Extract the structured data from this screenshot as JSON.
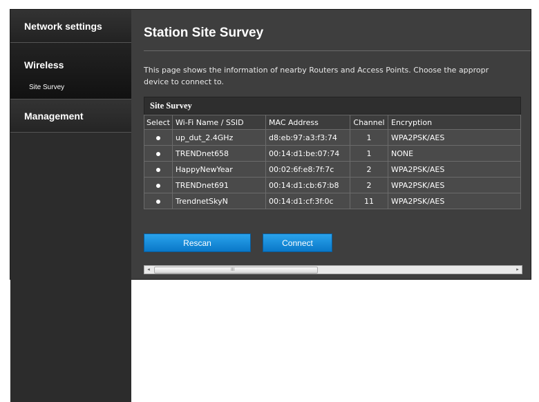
{
  "sidebar": {
    "items": [
      {
        "label": "Network settings"
      },
      {
        "label": "Wireless",
        "sub": "Site Survey"
      },
      {
        "label": "Management"
      }
    ]
  },
  "main": {
    "title": "Station Site Survey",
    "description_line1": "This page shows the information of nearby Routers and Access Points. Choose the appropr",
    "description_line2": "device to connect to."
  },
  "survey": {
    "caption": "Site Survey",
    "columns": [
      "Select",
      "Wi-Fi Name / SSID",
      "MAC Address",
      "Channel",
      "Encryption"
    ],
    "rows": [
      {
        "ssid": "up_dut_2.4GHz",
        "mac": "d8:eb:97:a3:f3:74",
        "channel": "1",
        "encryption": "WPA2PSK/AES"
      },
      {
        "ssid": "TRENDnet658",
        "mac": "00:14:d1:be:07:74",
        "channel": "1",
        "encryption": "NONE"
      },
      {
        "ssid": "HappyNewYear",
        "mac": "00:02:6f:e8:7f:7c",
        "channel": "2",
        "encryption": "WPA2PSK/AES"
      },
      {
        "ssid": "TRENDnet691",
        "mac": "00:14:d1:cb:67:b8",
        "channel": "2",
        "encryption": "WPA2PSK/AES"
      },
      {
        "ssid": "TrendnetSkyN",
        "mac": "00:14:d1:cf:3f:0c",
        "channel": "11",
        "encryption": "WPA2PSK/AES"
      }
    ]
  },
  "buttons": {
    "rescan": "Rescan",
    "connect": "Connect"
  },
  "scrollbar": {
    "left_arrow": "◂",
    "right_arrow": "▸",
    "grip": "III"
  },
  "colors": {
    "accent_button": "#1a8fe0",
    "background": "#3e3e3e"
  }
}
